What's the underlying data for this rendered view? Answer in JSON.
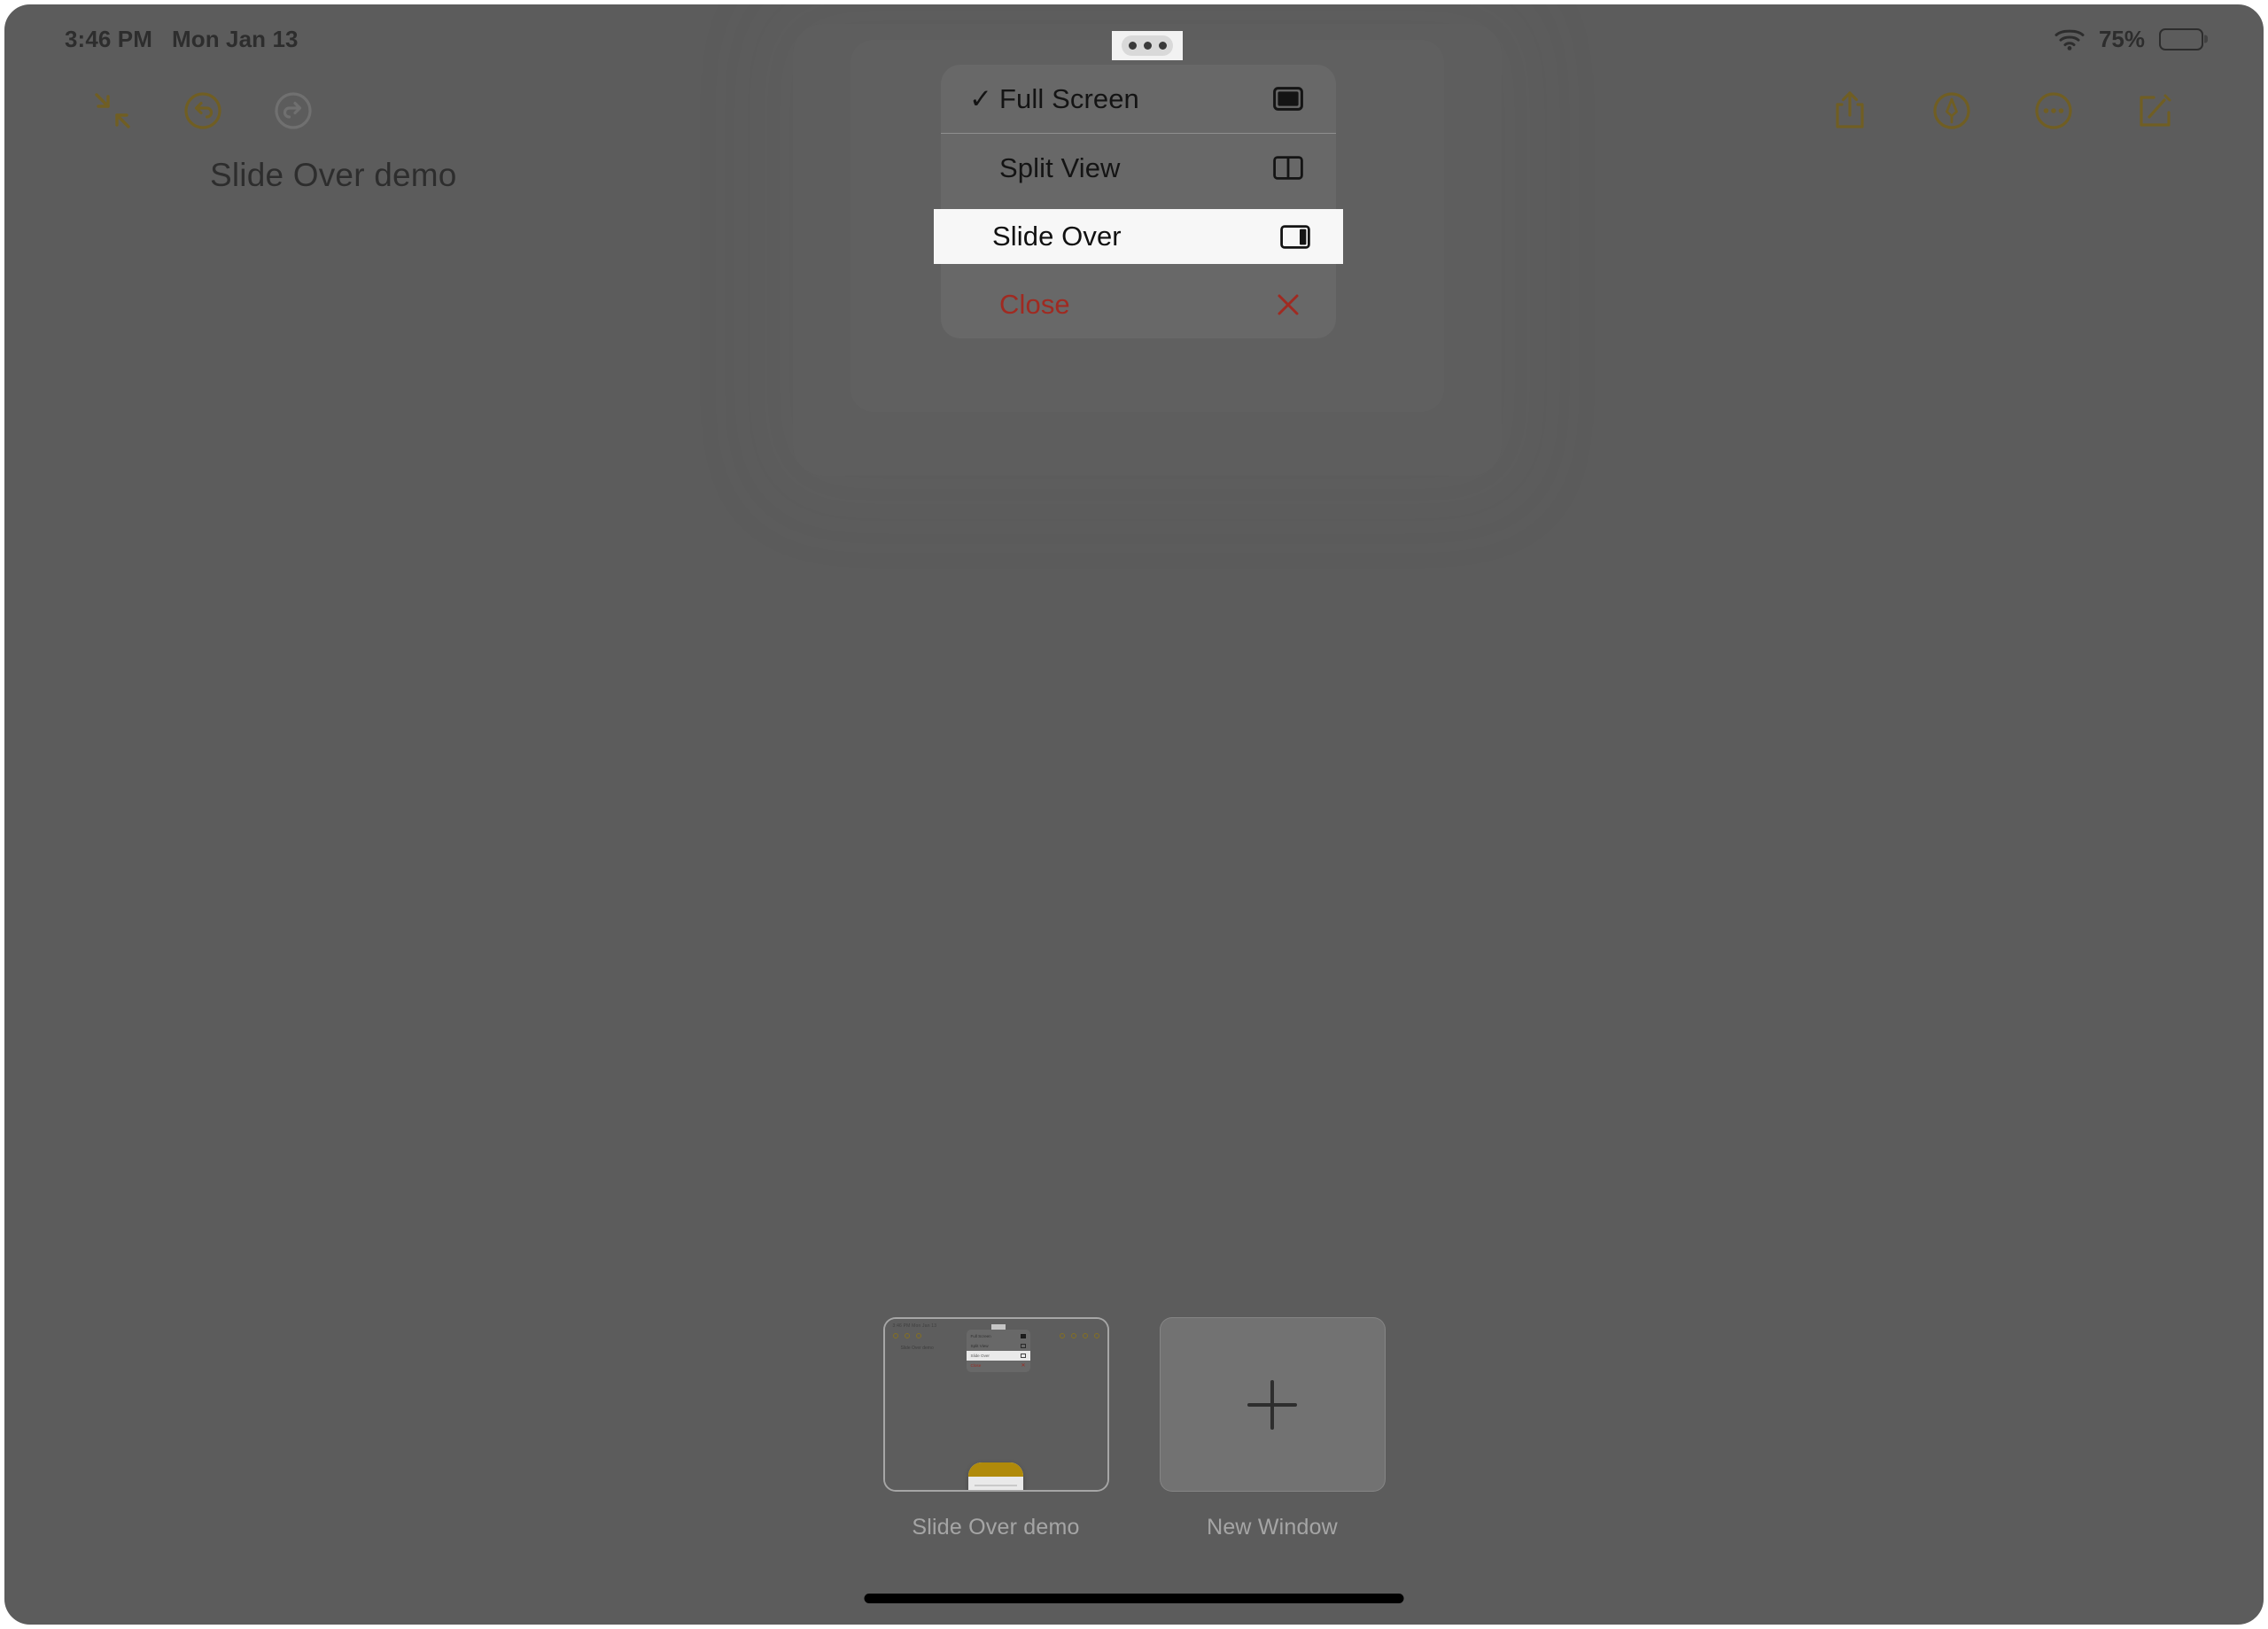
{
  "status_bar": {
    "time": "3:46 PM",
    "date": "Mon Jan 13",
    "battery_percent": "75%",
    "wifi_icon": "wifi-icon",
    "battery_icon": "battery-icon",
    "battery_level": 75
  },
  "toolbar": {
    "left": [
      {
        "name": "collapse-icon",
        "label": "Collapse",
        "state": "enabled",
        "color": "#8a6d0b"
      },
      {
        "name": "undo-icon",
        "label": "Undo",
        "state": "enabled",
        "color": "#8a6d0b"
      },
      {
        "name": "redo-icon",
        "label": "Redo",
        "state": "disabled",
        "color": "#8a8a8a"
      }
    ],
    "right": [
      {
        "name": "share-icon",
        "label": "Share",
        "state": "enabled",
        "color": "#8a6d0b"
      },
      {
        "name": "markup-icon",
        "label": "Markup",
        "state": "enabled",
        "color": "#8a6d0b"
      },
      {
        "name": "more-icon",
        "label": "More",
        "state": "enabled",
        "color": "#8a6d0b"
      },
      {
        "name": "compose-icon",
        "label": "New Note",
        "state": "enabled",
        "color": "#8a6d0b"
      }
    ]
  },
  "note": {
    "title": "Slide Over demo"
  },
  "multitasking_menu": {
    "handle_icon": "three-dots-handle",
    "items": [
      {
        "label": "Full Screen",
        "icon": "full-screen-icon",
        "checked": true,
        "selected": false,
        "destructive": false,
        "check_glyph": "✓"
      },
      {
        "label": "Split View",
        "icon": "split-view-icon",
        "checked": false,
        "selected": false,
        "destructive": false,
        "check_glyph": ""
      },
      {
        "label": "Slide Over",
        "icon": "slide-over-icon",
        "checked": false,
        "selected": true,
        "destructive": false,
        "check_glyph": ""
      },
      {
        "label": "Close",
        "icon": "close-x-icon",
        "checked": false,
        "selected": false,
        "destructive": true,
        "check_glyph": ""
      }
    ]
  },
  "shelf": {
    "tiles": [
      {
        "label": "Slide Over demo",
        "type": "window",
        "app_icon": "notes-app-icon"
      },
      {
        "label": "New Window",
        "type": "new-window",
        "app_icon": "plus-icon"
      }
    ],
    "mini_preview": {
      "status": "3:46 PM  Mon Jan 13",
      "title": "Slide Over demo",
      "menu_items": [
        "Full Screen",
        "Split View",
        "Slide Over",
        "Close"
      ]
    }
  },
  "home_indicator": {
    "name": "home-indicator"
  },
  "colors": {
    "screen_background": "#6a6a6a",
    "accent_gold": "#8a6d0b",
    "destructive_red": "#a02a21",
    "menu_background": "rgba(120,120,120,0.34)",
    "selected_row": "#f7f7f7",
    "home_indicator": "#000000"
  }
}
